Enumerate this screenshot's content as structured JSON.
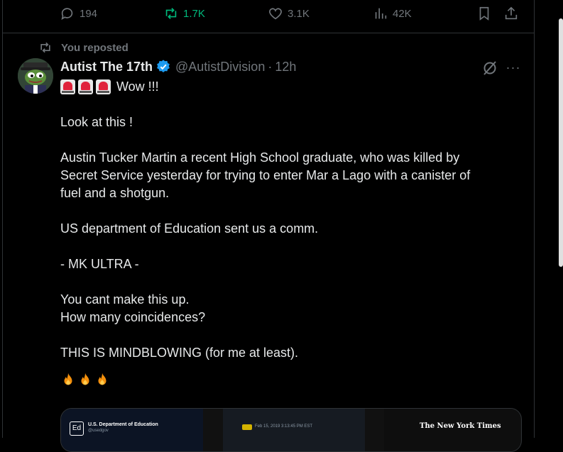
{
  "actions": {
    "replies": "194",
    "reposts": "1.7K",
    "likes": "3.1K",
    "views": "42K"
  },
  "repost_label": "You reposted",
  "tweet": {
    "display_name": "Autist The 17th",
    "handle": "@AutistDivision",
    "separator": "·",
    "time": "12h",
    "more": "···",
    "lead": "Wow !!!",
    "paragraphs": [
      [
        "Look at this !"
      ],
      [
        "Austin Tucker Martin a recent High School graduate, who was killed by",
        "Secret Service yesterday for trying to enter Mar a Lago with a canister of",
        "fuel and a shotgun."
      ],
      [
        "US department of Education sent us a comm."
      ],
      [
        "- MK ULTRA -"
      ],
      [
        "You cant make this up.",
        "How many coincidences?"
      ],
      [
        "THIS IS MINDBLOWING (for me at least)."
      ]
    ],
    "emoji_names": [
      "siren-emoji",
      "fire-emoji"
    ],
    "media": {
      "ed_name": "U.S. Department of Education",
      "ed_handle": "@usedgov",
      "tag_date": "Feb 15, 2019 3:13:45 PM EST",
      "nyt": "The New York Times"
    }
  },
  "colors": {
    "background": "#000000",
    "text": "#e7e9ea",
    "muted": "#71767b",
    "repost_green": "#00ba7c",
    "verified_blue": "#1d9bf0",
    "border": "#2f3336"
  }
}
